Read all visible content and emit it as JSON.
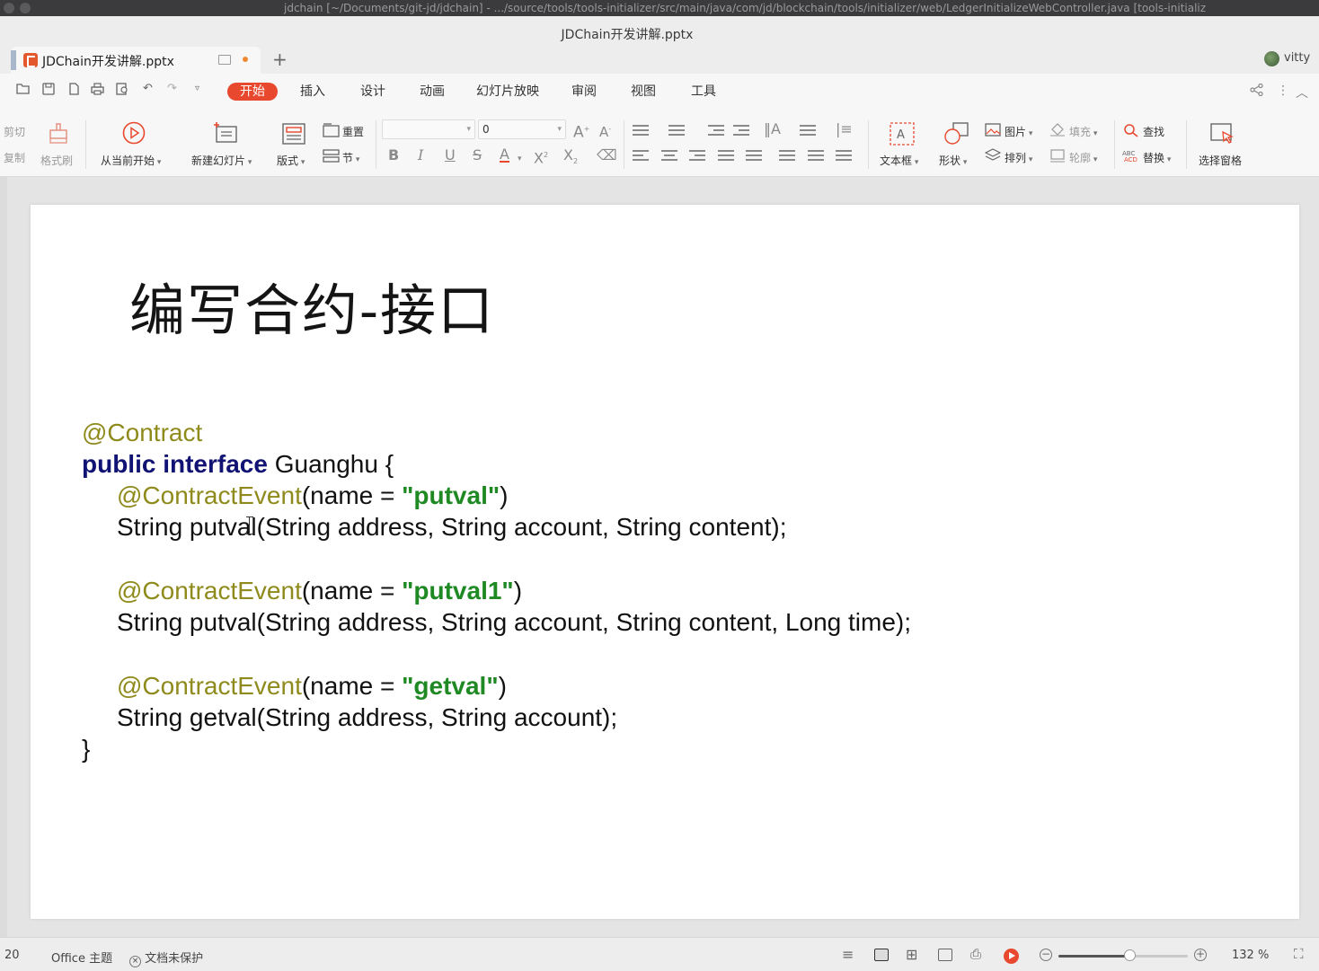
{
  "os": {
    "title": "jdchain [~/Documents/git-jd/jdchain] - .../source/tools/tools-initializer/src/main/java/com/jd/blockchain/tools/initializer/web/LedgerInitializeWebController.java [tools-initializ"
  },
  "window": {
    "title": "JDChain开发讲解.pptx"
  },
  "tabs": {
    "doc_tab_label": "JDChain开发讲解.pptx",
    "new_tab": "+",
    "user_name": "vitty"
  },
  "menu": {
    "tabs": [
      "开始",
      "插入",
      "设计",
      "动画",
      "幻灯片放映",
      "审阅",
      "视图",
      "工具"
    ],
    "active_index": 0
  },
  "ribbon": {
    "cut": "剪切",
    "copy": "复制",
    "format_painter": "格式刷",
    "play_from_current": "从当前开始",
    "new_slide": "新建幻灯片",
    "layout": "版式",
    "reset": "重置",
    "section": "节",
    "font_name": "",
    "font_size": "0",
    "text_box": "文本框",
    "shape": "形状",
    "picture": "图片",
    "arrange": "排列",
    "fill": "填充",
    "outline": "轮廓",
    "find": "查找",
    "replace": "替换",
    "selection_pane": "选择窗格"
  },
  "slide": {
    "title": "编写合约-接口",
    "code": {
      "line1": "@Contract",
      "line2_kw": "public interface",
      "line2_rest": " Guanghu {",
      "ev1_anno": "@ContractEvent",
      "ev1_mid": "(name = ",
      "ev1_str": "\"putval\"",
      "ev1_end": ")",
      "ev1_sig": "String putval(String address, String account, String content);",
      "ev2_anno": "@ContractEvent",
      "ev2_mid": "(name = ",
      "ev2_str": "\"putval1\"",
      "ev2_end": ")",
      "ev2_sig": "String putval(String address, String account, String content, Long time);",
      "ev3_anno": "@ContractEvent",
      "ev3_mid": "(name = ",
      "ev3_str": "\"getval\"",
      "ev3_end": ")",
      "ev3_sig": "String getval(String address, String account);",
      "close": "}"
    }
  },
  "status": {
    "slide_number": "20",
    "theme": "Office 主题",
    "protection": "文档未保护",
    "zoom": "132 %",
    "zoom_level": 0.55
  },
  "colors": {
    "accent": "#e8482e",
    "annotation": "#8f8a1c",
    "keyword": "#101373",
    "string": "#1f8a23"
  }
}
